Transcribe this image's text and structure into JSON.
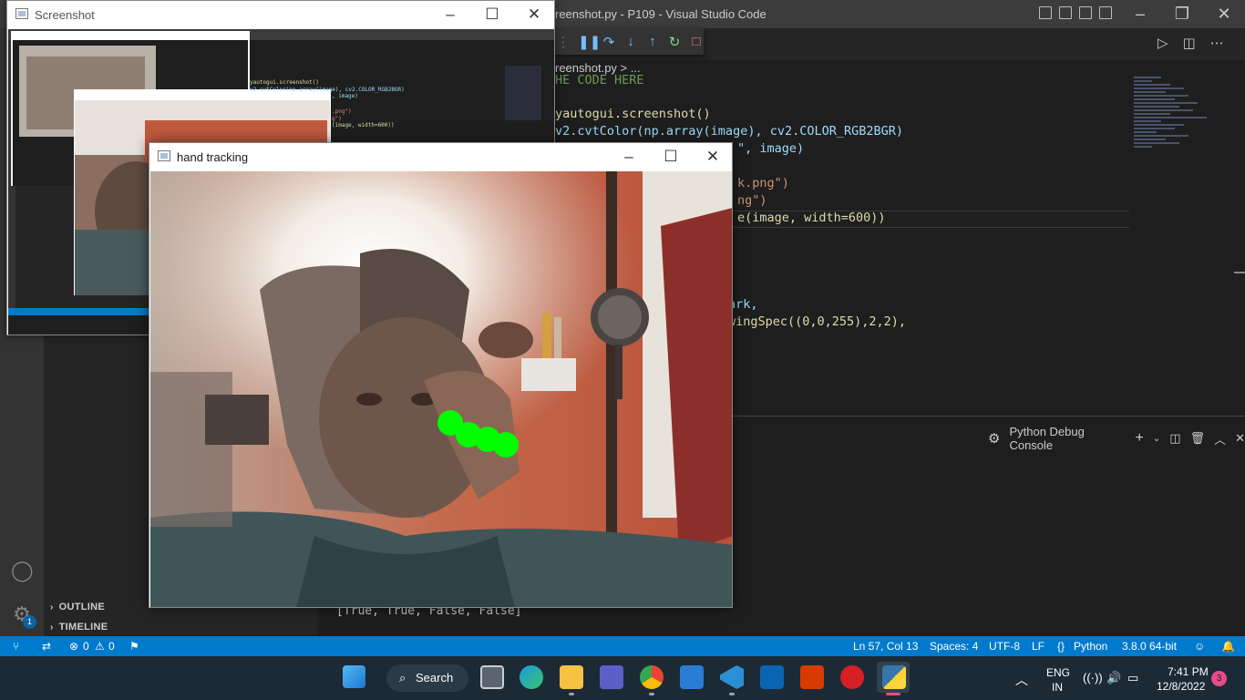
{
  "vscode": {
    "title": "reenshot.py - P109 - Visual Studio Code",
    "breadcrumb": "reenshot.py > ...",
    "code_lines": [
      {
        "text": "HE CODE HERE",
        "color": "#6a9955"
      },
      {
        "text": "yautogui.screenshot()",
        "color": "#dcdcaa"
      },
      {
        "text": "v2.cvtColor(np.array(image), cv2.COLOR_RGB2BGR)",
        "color": "#9cdcfe"
      },
      {
        "text": "\", image)",
        "color": "#9cdcfe"
      },
      {
        "text": "k.png\")",
        "color": "#ce9178"
      },
      {
        "text": "ng\")",
        "color": "#ce9178"
      },
      {
        "text": "e(image, width=600))",
        "color": "#dcdcaa"
      },
      {
        "text": "ark,",
        "color": "#9cdcfe"
      },
      {
        "text": "wingSpec((0,0,255),2,2),",
        "color": "#dcdcaa"
      }
    ],
    "panel_title": "Python Debug Console",
    "panel_output": "[True, True, False, False]",
    "sidebar_sections": {
      "outline": "OUTLINE",
      "timeline": "TIMELINE"
    },
    "settings_badge": "1",
    "status": {
      "errors": "0",
      "warnings": "0",
      "position": "Ln 57, Col 13",
      "spaces": "Spaces: 4",
      "encoding": "UTF-8",
      "eol": "LF",
      "language": "Python",
      "interpreter": "3.8.0 64-bit"
    }
  },
  "screenshot_window": {
    "title": "Screenshot"
  },
  "hand_window": {
    "title": "hand tracking"
  },
  "taskbar": {
    "search_label": "Search",
    "lang": "ENG",
    "lang_sub": "IN",
    "time": "7:41 PM",
    "date": "12/8/2022",
    "notifications": "3"
  },
  "colors": {
    "accent": "#007acc",
    "landmark": "#00ff00"
  }
}
